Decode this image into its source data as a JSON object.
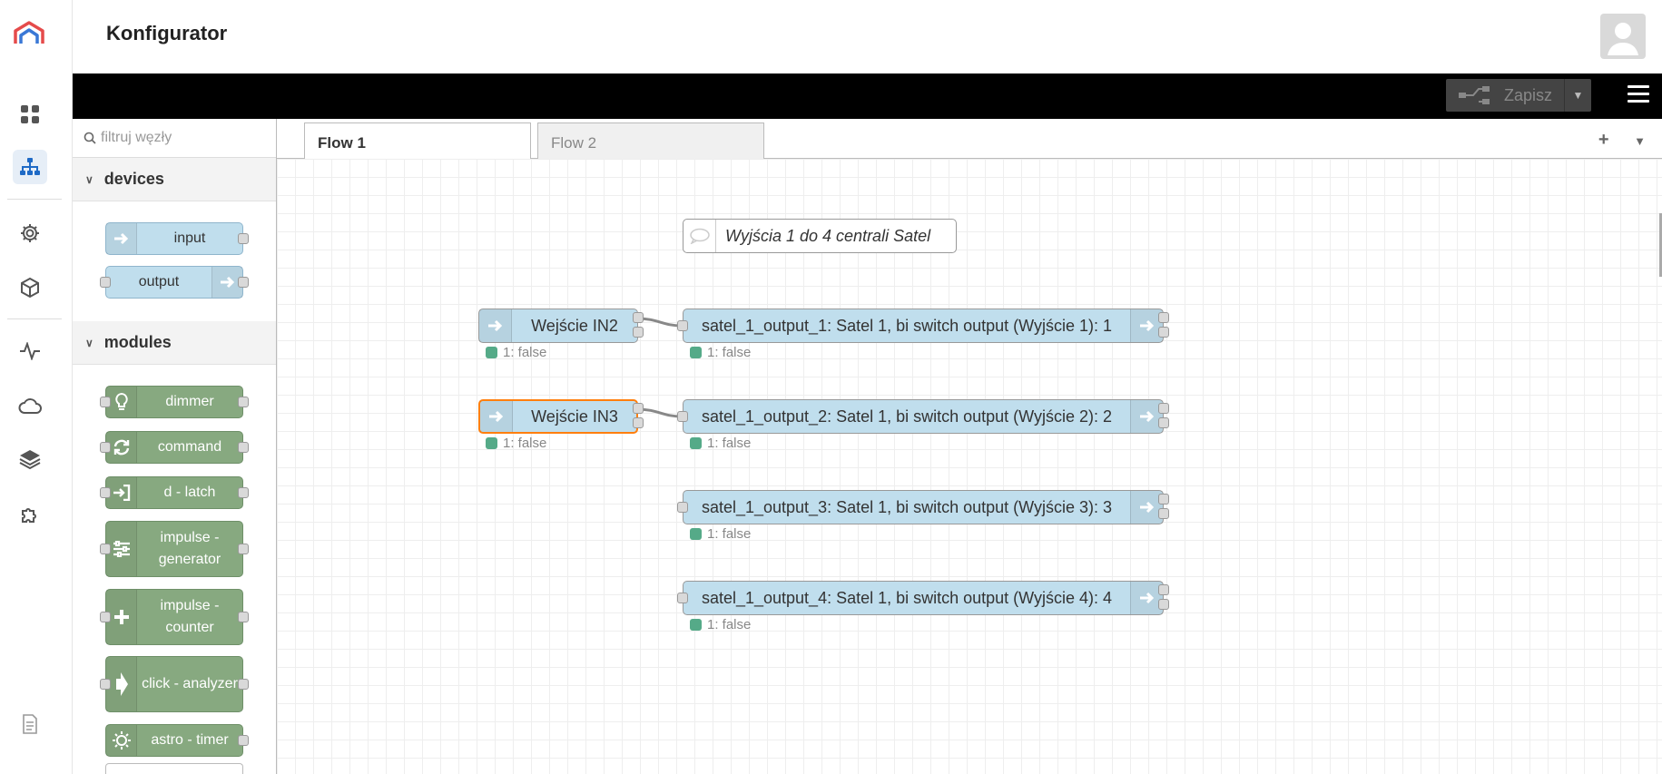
{
  "app": {
    "title": "Konfigurator"
  },
  "rail": {
    "items": [
      {
        "icon": "dashboard-icon"
      },
      {
        "icon": "flow-tree-icon",
        "active": true
      },
      {
        "icon": "gear-icon"
      },
      {
        "icon": "cube-icon"
      },
      {
        "icon": "activity-icon"
      },
      {
        "icon": "cloud-icon"
      },
      {
        "icon": "layers-icon"
      },
      {
        "icon": "puzzle-icon"
      },
      {
        "icon": "document-icon"
      }
    ]
  },
  "header": {
    "deploy_label": "Zapisz"
  },
  "palette": {
    "search_placeholder": "filtruj węzły",
    "categories": [
      {
        "name": "devices",
        "nodes": [
          {
            "label": "input",
            "color": "#c0deed"
          },
          {
            "label": "output",
            "color": "#c0deed"
          }
        ]
      },
      {
        "name": "modules",
        "nodes": [
          {
            "label": "dimmer",
            "icon": "bulb-icon"
          },
          {
            "label": "command",
            "icon": "refresh-icon"
          },
          {
            "label": "d - latch",
            "icon": "sign-in-icon"
          },
          {
            "label": "impulse - generator",
            "icon": "sliders-icon"
          },
          {
            "label": "impulse - counter",
            "icon": "plus-icon"
          },
          {
            "label": "click - analyzer",
            "icon": "arrow-right-icon"
          },
          {
            "label": "astro - timer",
            "icon": "sun-icon"
          }
        ]
      }
    ]
  },
  "tabs": [
    {
      "label": "Flow 1",
      "active": true
    },
    {
      "label": "Flow 2",
      "active": false
    }
  ],
  "workspace": {
    "comment": "Wyjścia 1 do 4 centrali Satel",
    "inputs": [
      {
        "label": "Wejście IN2",
        "status": "1: false"
      },
      {
        "label": "Wejście IN3",
        "status": "1: false",
        "selected": true
      }
    ],
    "outputs": [
      {
        "label": "satel_1_output_1: Satel 1, bi switch output (Wyjście 1): 1",
        "status": "1: false"
      },
      {
        "label": "satel_1_output_2: Satel 1, bi switch output (Wyjście 2): 2",
        "status": "1: false"
      },
      {
        "label": "satel_1_output_3: Satel 1, bi switch output (Wyjście 3): 3",
        "status": "1: false"
      },
      {
        "label": "satel_1_output_4: Satel 1, bi switch output (Wyjście 4): 4",
        "status": "1: false"
      }
    ]
  },
  "colors": {
    "accent": "#1e6ac6",
    "node_blue": "#c0deed",
    "node_green": "#87a980",
    "selected": "#ff7f0e",
    "status_ok": "#55aa88"
  }
}
